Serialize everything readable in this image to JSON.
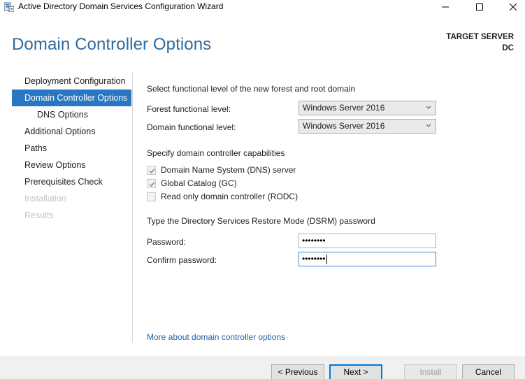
{
  "window": {
    "title": "Active Directory Domain Services Configuration Wizard"
  },
  "header": {
    "page_title": "Domain Controller Options",
    "target_label": "TARGET SERVER",
    "target_name": "DC"
  },
  "nav": {
    "items": [
      {
        "label": "Deployment Configuration",
        "state": "normal"
      },
      {
        "label": "Domain Controller Options",
        "state": "selected"
      },
      {
        "label": "DNS Options",
        "state": "sub"
      },
      {
        "label": "Additional Options",
        "state": "normal"
      },
      {
        "label": "Paths",
        "state": "normal"
      },
      {
        "label": "Review Options",
        "state": "normal"
      },
      {
        "label": "Prerequisites Check",
        "state": "normal"
      },
      {
        "label": "Installation",
        "state": "disabled"
      },
      {
        "label": "Results",
        "state": "disabled"
      }
    ]
  },
  "functional": {
    "heading": "Select functional level of the new forest and root domain",
    "forest_label": "Forest functional level:",
    "forest_value": "Windows Server 2016",
    "domain_label": "Domain functional level:",
    "domain_value": "Windows Server 2016"
  },
  "capabilities": {
    "heading": "Specify domain controller capabilities",
    "dns": {
      "label": "Domain Name System (DNS) server",
      "checked": true
    },
    "gc": {
      "label": "Global Catalog (GC)",
      "checked": true
    },
    "rodc": {
      "label": "Read only domain controller (RODC)",
      "checked": false
    }
  },
  "dsrm": {
    "heading": "Type the Directory Services Restore Mode (DSRM) password",
    "password_label": "Password:",
    "password_value": "••••••••",
    "confirm_label": "Confirm password:",
    "confirm_value": "••••••••"
  },
  "more_link": "More about domain controller options",
  "footer": {
    "previous": "< Previous",
    "next": "Next >",
    "install": "Install",
    "cancel": "Cancel"
  },
  "colors": {
    "title_blue": "#2c6aa0",
    "nav_selected": "#2976c3",
    "link": "#2862a6"
  }
}
